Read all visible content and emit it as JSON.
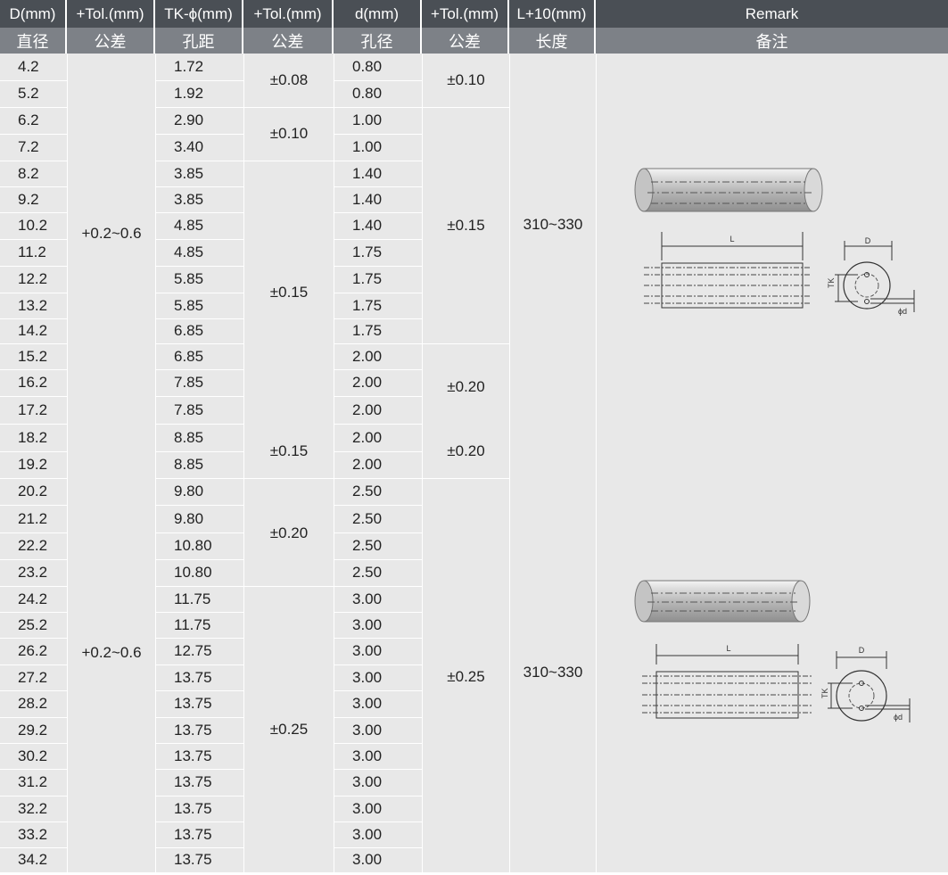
{
  "header": {
    "en": [
      "D(mm)",
      "+Tol.(mm)",
      "TK-ϕ(mm)",
      "+Tol.(mm)",
      "d(mm)",
      "+Tol.(mm)",
      "L+10(mm)",
      "Remark"
    ],
    "zh": [
      "直径",
      "公差",
      "孔距",
      "公差",
      "孔径",
      "公差",
      "长度",
      "备注"
    ]
  },
  "D": [
    "4.2",
    "5.2",
    "6.2",
    "7.2",
    "8.2",
    "9.2",
    "10.2",
    "11.2",
    "12.2",
    "13.2",
    "14.2",
    "15.2",
    "16.2",
    "17.2",
    "18.2",
    "19.2",
    "20.2",
    "21.2",
    "22.2",
    "23.2",
    "24.2",
    "25.2",
    "26.2",
    "27.2",
    "28.2",
    "29.2",
    "30.2",
    "31.2",
    "32.2",
    "33.2",
    "34.2"
  ],
  "TK": [
    "1.72",
    "1.92",
    "2.90",
    "3.40",
    "3.85",
    "3.85",
    "4.85",
    "4.85",
    "5.85",
    "5.85",
    "6.85",
    "6.85",
    "7.85",
    "7.85",
    "8.85",
    "8.85",
    "9.80",
    "9.80",
    "10.80",
    "10.80",
    "11.75",
    "11.75",
    "12.75",
    "13.75",
    "13.75",
    "13.75",
    "13.75",
    "13.75",
    "13.75",
    "13.75",
    "13.75"
  ],
  "d": [
    "0.80",
    "0.80",
    "1.00",
    "1.00",
    "1.40",
    "1.40",
    "1.40",
    "1.75",
    "1.75",
    "1.75",
    "1.75",
    "2.00",
    "2.00",
    "2.00",
    "2.00",
    "2.00",
    "2.50",
    "2.50",
    "2.50",
    "2.50",
    "3.00",
    "3.00",
    "3.00",
    "3.00",
    "3.00",
    "3.00",
    "3.00",
    "3.00",
    "3.00",
    "3.00",
    "3.00"
  ],
  "tolD": [
    "+0.2~0.6",
    "+0.2~0.6"
  ],
  "tolTK": [
    "±0.08",
    "±0.10",
    "±0.15",
    "±0.15",
    "±0.20",
    "±0.25"
  ],
  "told": [
    "±0.10",
    "±0.15",
    "±0.20",
    "±0.20",
    "±0.25"
  ],
  "length": [
    "310~330",
    "310~330"
  ],
  "drawing_labels": {
    "L": "L",
    "D": "D",
    "TK": "TK",
    "d": "ϕd"
  }
}
